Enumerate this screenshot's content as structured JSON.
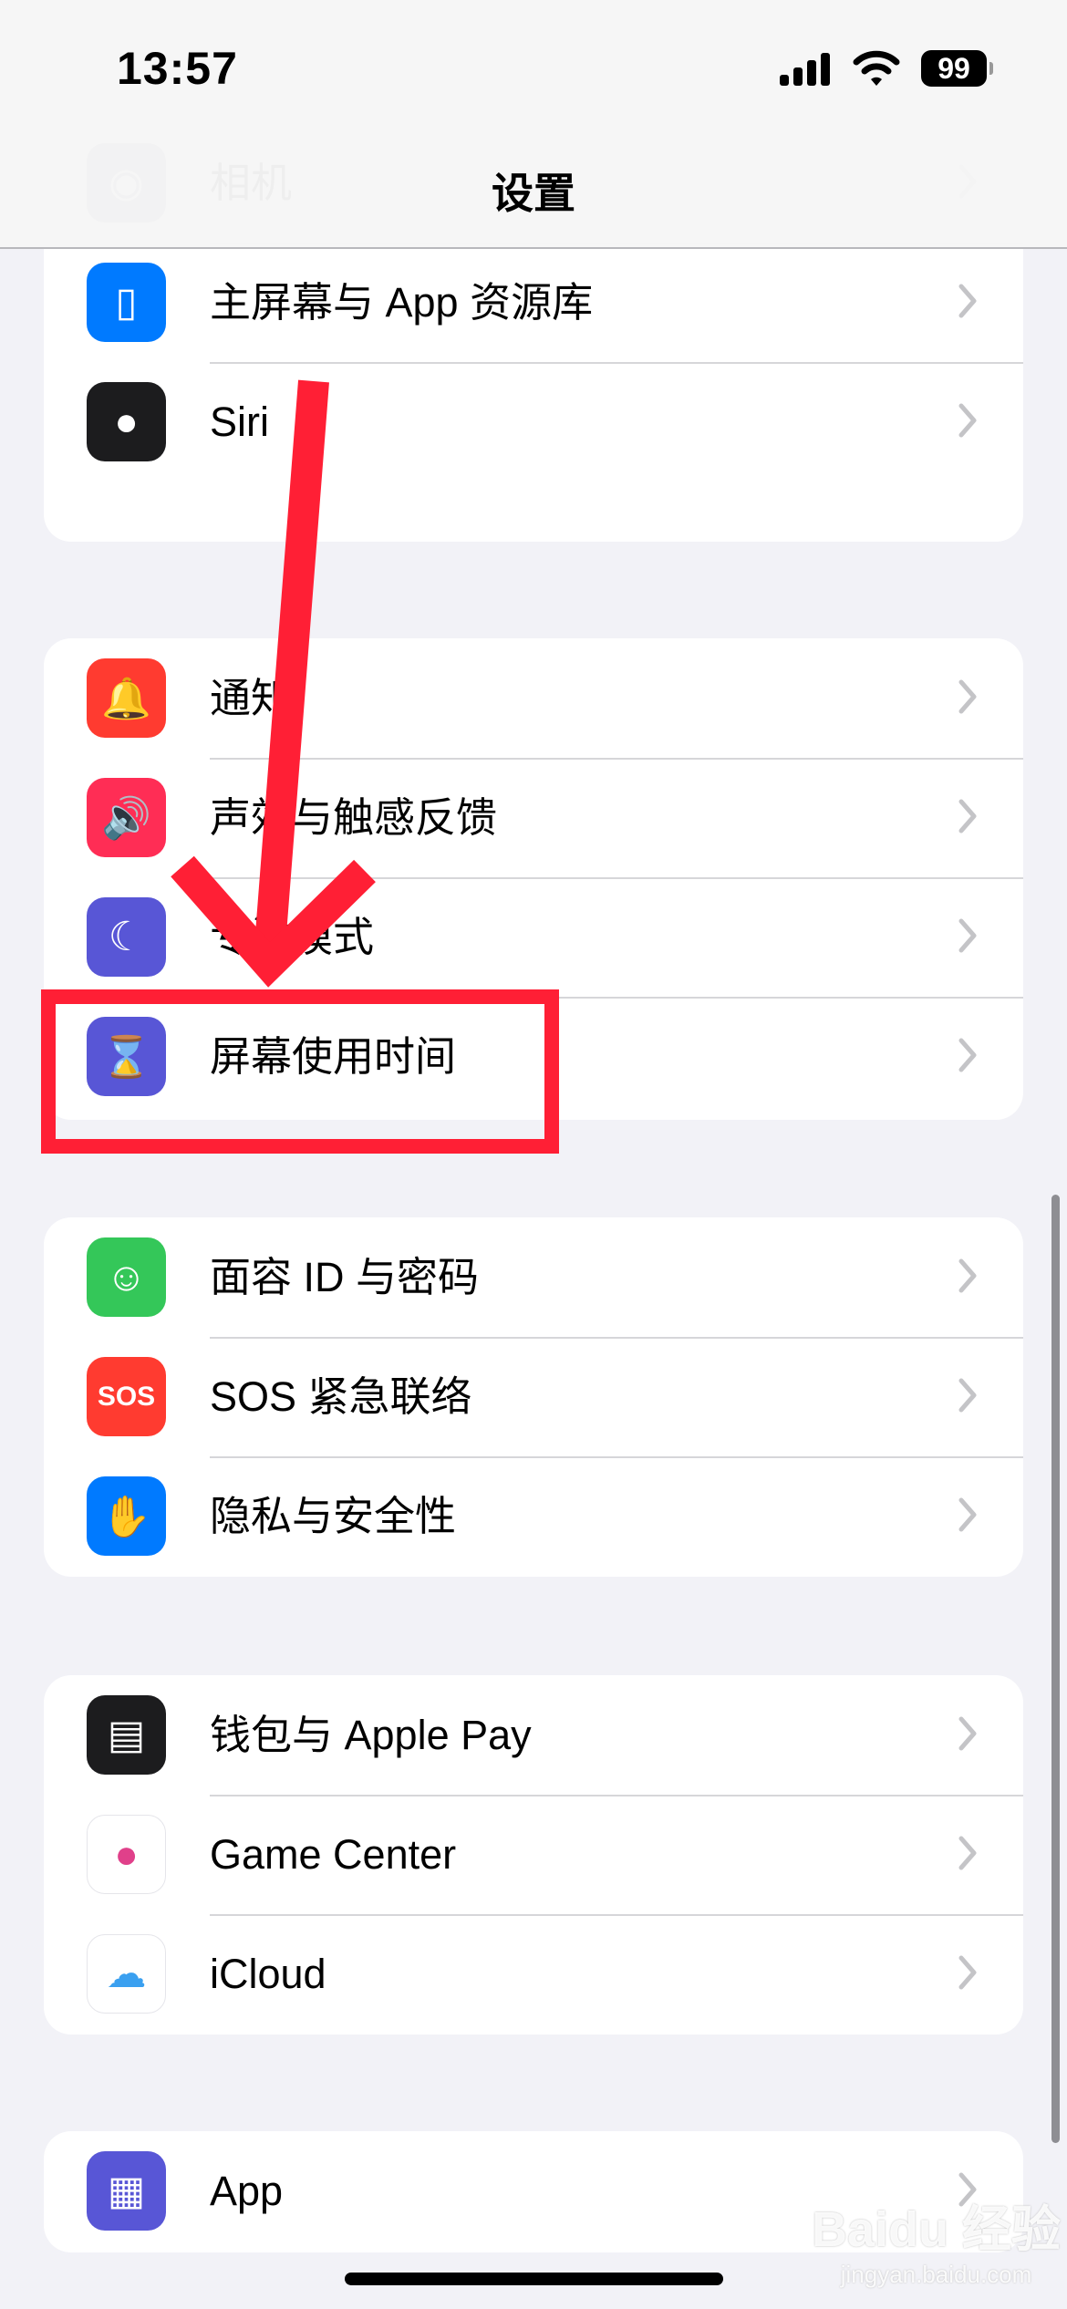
{
  "status_bar": {
    "time": "13:57",
    "battery": "99"
  },
  "nav": {
    "title": "设置"
  },
  "groups": [
    {
      "items": [
        {
          "label": "相机",
          "icon": "camera-icon",
          "color": "#8e8e93"
        },
        {
          "label": "主屏幕与 App 资源库",
          "icon": "home-screen-icon",
          "color": "#007aff"
        },
        {
          "label": "Siri",
          "icon": "siri-icon",
          "color": "#1c1c1e"
        }
      ]
    },
    {
      "items": [
        {
          "label": "通知",
          "icon": "bell-icon",
          "color": "#ff3b30"
        },
        {
          "label": "声效与触感反馈",
          "icon": "speaker-icon",
          "color": "#ff2d55"
        },
        {
          "label": "专注模式",
          "icon": "moon-icon",
          "color": "#5856d6"
        },
        {
          "label": "屏幕使用时间",
          "icon": "hourglass-icon",
          "color": "#5856d6"
        }
      ]
    },
    {
      "items": [
        {
          "label": "面容 ID 与密码",
          "icon": "face-id-icon",
          "color": "#34c759"
        },
        {
          "label": "SOS 紧急联络",
          "icon": "sos-icon",
          "color": "#ff3b30",
          "glyph": "SOS"
        },
        {
          "label": "隐私与安全性",
          "icon": "hand-icon",
          "color": "#007aff"
        }
      ]
    },
    {
      "items": [
        {
          "label": "钱包与 Apple Pay",
          "icon": "wallet-icon",
          "color": "#1c1c1e"
        },
        {
          "label": "Game Center",
          "icon": "game-center-icon",
          "color": "#ffffff"
        },
        {
          "label": "iCloud",
          "icon": "icloud-icon",
          "color": "#ffffff"
        }
      ]
    },
    {
      "items": [
        {
          "label": "App",
          "icon": "apps-icon",
          "color": "#5856d6"
        }
      ]
    }
  ],
  "annotation": {
    "color": "#ff1f35",
    "highlighted": "屏幕使用时间"
  },
  "watermark": {
    "brand": "Baidu 经验",
    "url": "jingyan.baidu.com"
  }
}
